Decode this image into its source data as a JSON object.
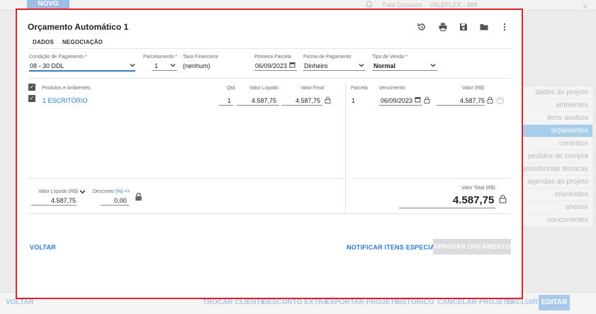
{
  "background": {
    "novo_label": "NOVO",
    "fale_conosco": "Fale Conosco",
    "user_label": "VALEFLEX - 889",
    "close_glyph": "×",
    "side_items": [
      {
        "label": "dados do projeto",
        "active": false
      },
      {
        "label": "ambientes",
        "active": false
      },
      {
        "label": "itens avulsos",
        "active": false
      },
      {
        "label": "orçamentos",
        "active": true
      },
      {
        "label": "contratos",
        "active": false
      },
      {
        "label": "pedidos de compra",
        "active": false
      },
      {
        "label": "assistências técnicas",
        "active": false
      },
      {
        "label": "agendas do projeto",
        "active": false
      },
      {
        "label": "envolvidos",
        "active": false
      },
      {
        "label": "anexos",
        "active": false
      },
      {
        "label": "concorrentes",
        "active": false
      }
    ],
    "bottom_buttons": {
      "voltar": "VOLTAR",
      "trocar_cliente": "TROCAR CLIENTE",
      "desconto_extra": "DESCONTO EXTRA",
      "exportar_projeto": "EXPORTAR PROJETO",
      "historico": "HISTÓRICO",
      "cancelar_projeto": "CANCELAR PROJETO",
      "excluir": "EXCLUIR",
      "editar": "EDITAR"
    }
  },
  "modal": {
    "title": "Orçamento Automático 1",
    "tabs": [
      "DADOS",
      "NEGOCIAÇÃO"
    ],
    "toolbar_icons": [
      "history-icon",
      "print-icon",
      "save-icon",
      "folder-icon",
      "more-vert-icon"
    ],
    "fields": {
      "condicao_label": "Condição de Pagamento *",
      "condicao_value": "08 - 30 DDL",
      "parcelamento_label": "Parcelamento *",
      "parcelamento_value": "1",
      "taxa_label": "Taxa Financeira",
      "taxa_value": "(nenhum)",
      "primeira_label": "Primeira Parcela",
      "primeira_value": "06/09/2023",
      "forma_label": "Forma de Pagamento",
      "forma_value": "Dinheiro",
      "tipo_label": "Tipo de Venda *",
      "tipo_value": "Normal"
    },
    "products": {
      "headers": {
        "produtos": "Produtos e Ambientes",
        "qtd": "Qtd.",
        "valor_liquido": "Valor Líquido",
        "valor_final": "Valor Final"
      },
      "rows": [
        {
          "name": "1 ESCRITÓRIO",
          "qtd": "1",
          "valor_liquido": "4.587,75",
          "valor_final": "4.587,75"
        }
      ]
    },
    "parcelas": {
      "headers": {
        "parcela": "Parcela",
        "vencimento": "Vencimento",
        "valor": "Valor (R$)"
      },
      "rows": [
        {
          "parcela": "1",
          "vencimento": "06/09/2023",
          "valor": "4.587,75"
        }
      ]
    },
    "totals": {
      "valor_liquido_label": "Valor Líquido (R$)",
      "valor_liquido_value": "4.587,75",
      "desconto_label": "Desconto",
      "desconto_toggle": "(%) <<",
      "desconto_value": "0,00",
      "valor_total_label": "Valor Total (R$)",
      "valor_total_value": "4.587,75"
    },
    "actions": {
      "voltar": "VOLTAR",
      "notificar": "NOTIFICAR ITENS ESPECIAIS",
      "aprovar": "APROVAR ORÇAMENTO"
    }
  },
  "colors": {
    "accent": "#2a7bd1",
    "highlight_border": "#e0202a",
    "active_side": "#a7cdea"
  }
}
